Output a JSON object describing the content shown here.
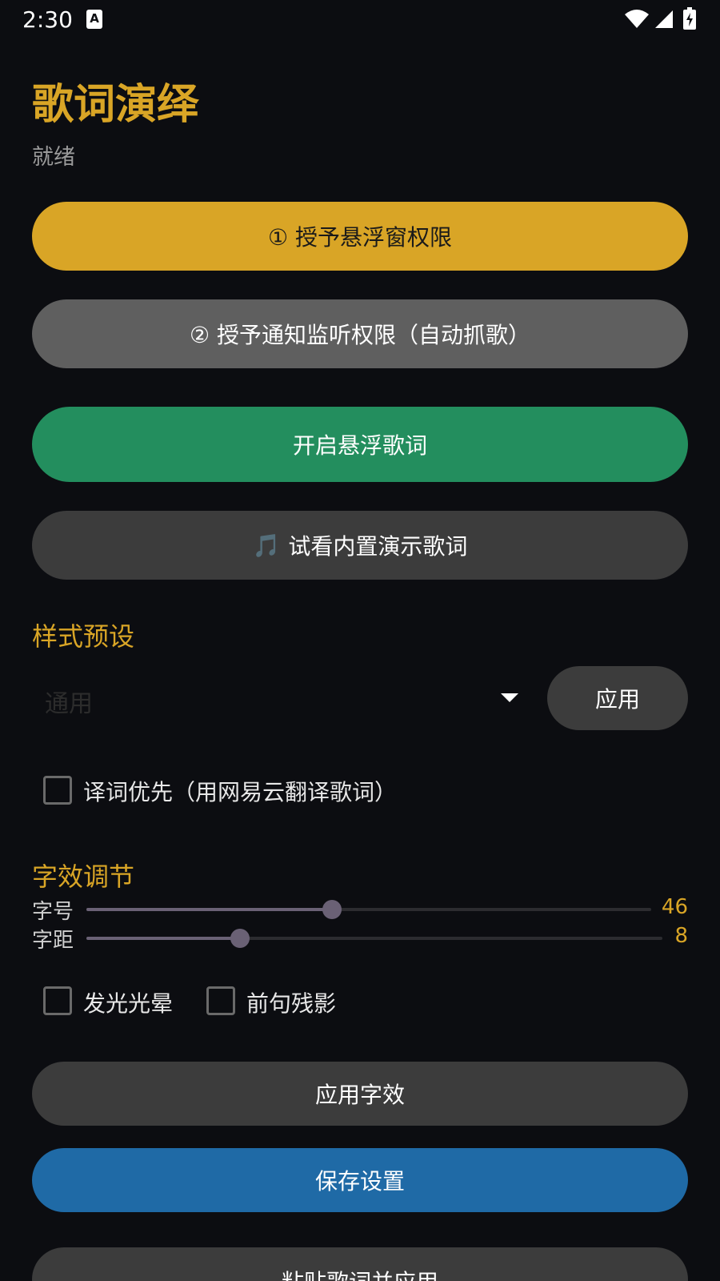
{
  "status_bar": {
    "time": "2:30",
    "notification_icon": "A"
  },
  "app": {
    "title": "歌词演绎",
    "status": "就绪"
  },
  "buttons": {
    "overlay_permission": "① 授予悬浮窗权限",
    "notification_permission": "② 授予通知监听权限（自动抓歌）",
    "start_floating": "开启悬浮歌词",
    "demo_icon": "🎵",
    "demo": "试看内置演示歌词",
    "apply_preset": "应用",
    "apply_effect": "应用字效",
    "save": "保存设置",
    "paste_apply": "粘贴歌词并应用"
  },
  "preset": {
    "section_title": "样式预设",
    "selected": "通用",
    "translation_first_label": "译词优先（用网易云翻译歌词）",
    "translation_first_checked": false
  },
  "effects": {
    "section_title": "字效调节",
    "font_size_label": "字号",
    "font_size_value": "46",
    "font_size_fraction": 0.435,
    "spacing_label": "字距",
    "spacing_value": "8",
    "spacing_fraction": 0.266,
    "glow_label": "发光光晕",
    "glow_checked": false,
    "ghost_label": "前句残影",
    "ghost_checked": false
  },
  "colors": {
    "accent": "#d9a526",
    "start_button": "#238e5e",
    "save_button": "#1f6aa6",
    "background": "#0c0d11"
  }
}
